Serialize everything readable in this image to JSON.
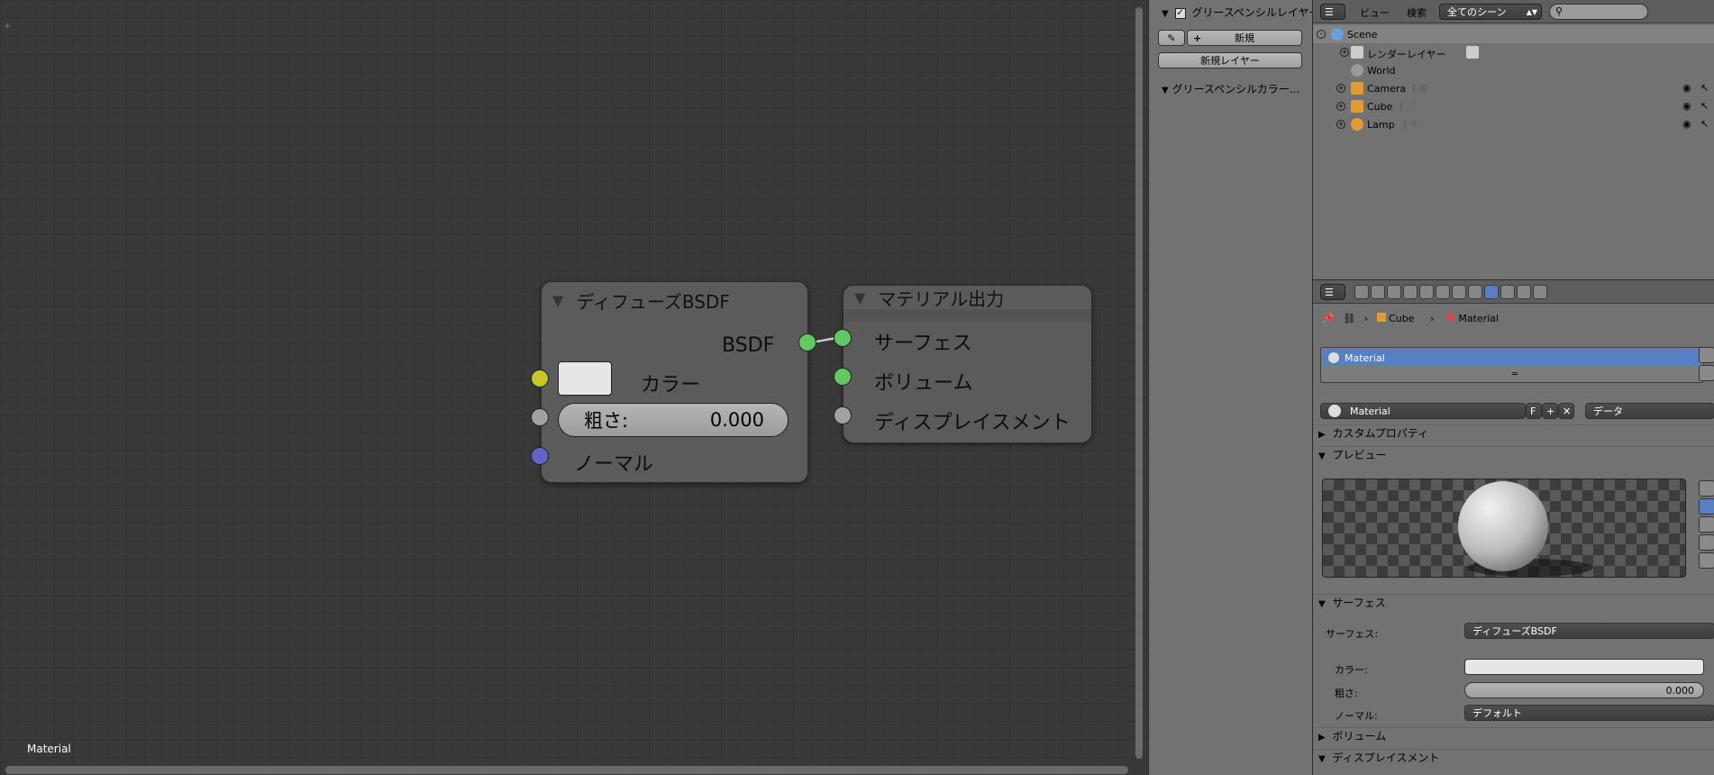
{
  "node_editor": {
    "footer_label": "Material",
    "diffuse_node": {
      "title": "ディフューズBSDF",
      "output_label": "BSDF",
      "color_label": "カラー",
      "roughness_label": "粗さ:",
      "roughness_value": "0.000",
      "normal_label": "ノーマル"
    },
    "output_node": {
      "title": "マテリアル出力",
      "surface_label": "サーフェス",
      "volume_label": "ボリューム",
      "displacement_label": "ディスプレイスメント"
    }
  },
  "grease_pencil": {
    "layer_panel_title": "グリースペンシルレイヤー",
    "new_button": "新規",
    "new_layer_button": "新規レイヤー",
    "color_panel_title": "グリースペンシルカラー..."
  },
  "outliner": {
    "menu_view": "ビュー",
    "menu_search": "検索",
    "scene_filter": "全てのシーン",
    "items": [
      {
        "label": "Scene"
      },
      {
        "label": "レンダーレイヤー"
      },
      {
        "label": "World"
      },
      {
        "label": "Camera"
      },
      {
        "label": "Cube"
      },
      {
        "label": "Lamp"
      }
    ]
  },
  "properties": {
    "breadcrumb": {
      "object": "Cube",
      "material": "Material"
    },
    "material_slot": "Material",
    "datablock": {
      "name": "Material",
      "fake_user": "F",
      "link": "データ"
    },
    "sections": {
      "custom_props": "カスタムプロパティ",
      "preview": "プレビュー",
      "surface": "サーフェス",
      "volume": "ボリューム",
      "displacement": "ディスプレイスメント"
    },
    "surface": {
      "surface_label": "サーフェス:",
      "surface_value": "ディフューズBSDF",
      "color_label": "カラー:",
      "roughness_label": "粗さ:",
      "roughness_value": "0.000",
      "normal_label": "ノーマル:",
      "normal_value": "デフォルト"
    }
  },
  "colors": {
    "accent": "#5680c2",
    "socket_shader": "#63c763",
    "socket_color": "#c7c729",
    "socket_value": "#a1a1a1",
    "socket_vector": "#6363c7"
  }
}
